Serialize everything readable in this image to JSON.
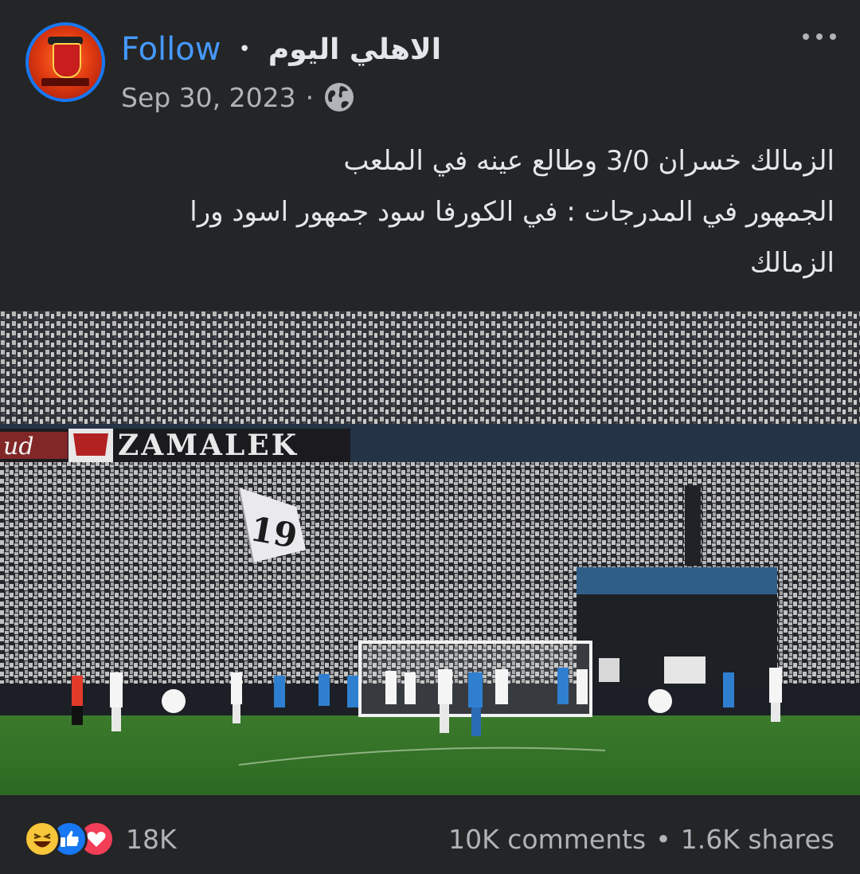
{
  "post": {
    "follow_label": "Follow",
    "separator": "•",
    "page_name": "الاهلي اليوم",
    "date": "Sep 30, 2023",
    "date_separator": "·",
    "audience_icon": "globe-icon",
    "more_icon": "more-options-icon",
    "text_lines": [
      "الزمالك خسران 3/0 وطالع عينه في الملعب",
      "الجمهور في المدرجات : في الكورفا سود جمهور اسود ورا",
      "الزمالك"
    ]
  },
  "photo": {
    "banner_text": "ZAMALEK",
    "banner_partial": "ud",
    "flag_text": "19"
  },
  "footer": {
    "reaction_icons": [
      "haha-icon",
      "like-icon",
      "love-icon"
    ],
    "reaction_count": "18K",
    "comments": "10K comments",
    "stats_separator": "•",
    "shares": "1.6K shares"
  },
  "colors": {
    "background": "#242526",
    "follow": "#4599ff",
    "secondary_text": "#b0b3b8",
    "primary_text": "#e4e6eb"
  }
}
